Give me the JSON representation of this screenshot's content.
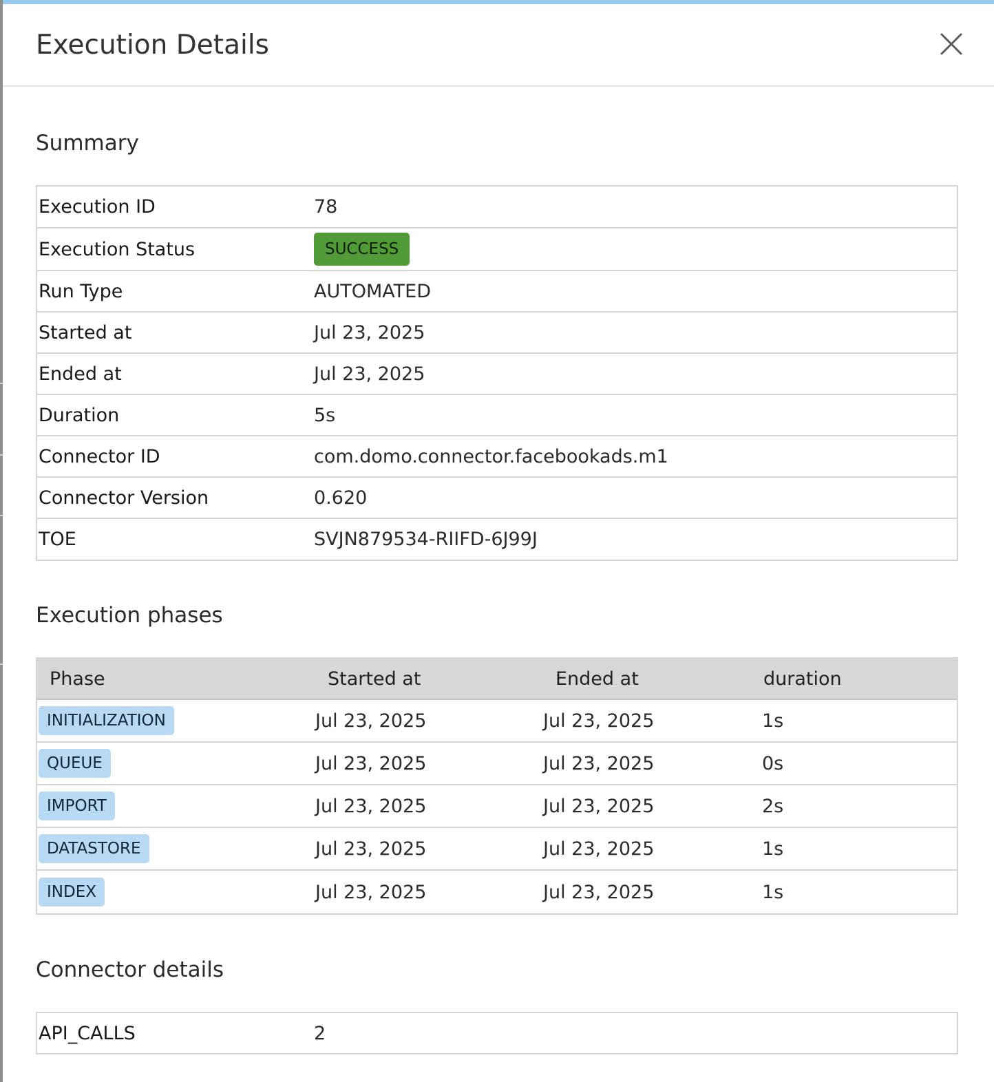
{
  "dialog": {
    "title": "Execution Details"
  },
  "summary": {
    "title": "Summary",
    "rows": [
      {
        "label": "Execution ID",
        "value": "78"
      },
      {
        "label": "Execution Status",
        "value": "SUCCESS"
      },
      {
        "label": "Run Type",
        "value": "AUTOMATED"
      },
      {
        "label": "Started at",
        "value": "Jul 23, 2025"
      },
      {
        "label": "Ended at",
        "value": "Jul 23, 2025"
      },
      {
        "label": "Duration",
        "value": "5s"
      },
      {
        "label": "Connector ID",
        "value": "com.domo.connector.facebookads.m1"
      },
      {
        "label": "Connector Version",
        "value": "0.620"
      },
      {
        "label": "TOE",
        "value": "SVJN879534-RIIFD-6J99J"
      }
    ]
  },
  "phases": {
    "title": "Execution phases",
    "columns": [
      "Phase",
      "Started at",
      "Ended at",
      "duration"
    ],
    "rows": [
      {
        "phase": "INITIALIZATION",
        "started": "Jul 23, 2025",
        "ended": "Jul 23, 2025",
        "duration": "1s"
      },
      {
        "phase": "QUEUE",
        "started": "Jul 23, 2025",
        "ended": "Jul 23, 2025",
        "duration": "0s"
      },
      {
        "phase": "IMPORT",
        "started": "Jul 23, 2025",
        "ended": "Jul 23, 2025",
        "duration": "2s"
      },
      {
        "phase": "DATASTORE",
        "started": "Jul 23, 2025",
        "ended": "Jul 23, 2025",
        "duration": "1s"
      },
      {
        "phase": "INDEX",
        "started": "Jul 23, 2025",
        "ended": "Jul 23, 2025",
        "duration": "1s"
      }
    ]
  },
  "connector": {
    "title": "Connector details",
    "rows": [
      {
        "label": "API_CALLS",
        "value": "2"
      }
    ]
  },
  "colors": {
    "accent_strip": "#99c9ed",
    "success_badge": "#519a38",
    "phase_badge": "#b7d9f3",
    "table_header": "#d7d7d7"
  },
  "icons": {
    "close": "close-icon"
  }
}
